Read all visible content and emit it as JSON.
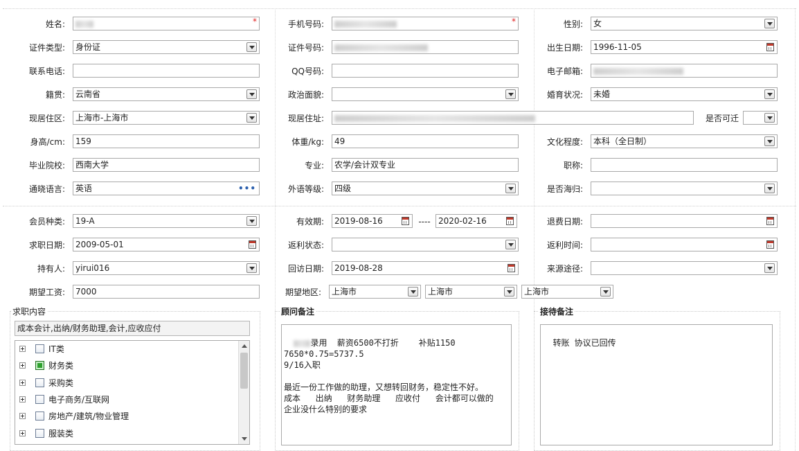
{
  "personal": {
    "name_label": "姓名:",
    "phone_label": "手机号码:",
    "gender_label": "性别:",
    "gender_value": "女",
    "id_type_label": "证件类型:",
    "id_type_value": "身份证",
    "id_no_label": "证件号码:",
    "birth_label": "出生日期:",
    "birth_value": "1996-11-05",
    "contact_label": "联系电话:",
    "qq_label": "QQ号码:",
    "email_label": "电子邮箱:",
    "native_label": "籍贯:",
    "native_value": "云南省",
    "politics_label": "政治面貌:",
    "marital_label": "婚育状况:",
    "marital_value": "未婚",
    "residence_area_label": "现居住区:",
    "residence_area_value": "上海市-上海市",
    "address_label": "现居住址:",
    "relocate_label": "是否可迁",
    "height_label": "身高/cm:",
    "height_value": "159",
    "weight_label": "体重/kg:",
    "weight_value": "49",
    "education_label": "文化程度:",
    "education_value": "本科（全日制）",
    "school_label": "毕业院校:",
    "school_value": "西南大学",
    "major_label": "专业:",
    "major_value": "农学/会计双专业",
    "title_label": "职称:",
    "language_label": "通晓语言:",
    "language_value": "英语",
    "foreign_level_label": "外语等级:",
    "foreign_level_value": "四级",
    "overseas_label": "是否海归:",
    "required_mark": "*"
  },
  "membership": {
    "type_label": "会员种类:",
    "type_value": "19-A",
    "valid_label": "有效期:",
    "valid_from": "2019-08-16",
    "valid_sep": "----",
    "valid_to": "2020-02-16",
    "refund_label": "退费日期:",
    "apply_label": "求职日期:",
    "apply_value": "2009-05-01",
    "rebate_status_label": "返利状态:",
    "rebate_time_label": "返利时间:",
    "holder_label": "持有人:",
    "holder_value": "yirui016",
    "revisit_label": "回访日期:",
    "revisit_value": "2019-08-28",
    "source_label": "来源途径:",
    "salary_label": "期望工资:",
    "salary_value": "7000",
    "region_label": "期望地区:",
    "region_1": "上海市",
    "region_2": "上海市",
    "region_3": "上海市"
  },
  "job": {
    "group_label": "求职内容",
    "summary": "成本会计,出纳/财务助理,会计,应收应付",
    "tree": [
      {
        "label": "IT类",
        "checked": false
      },
      {
        "label": "财务类",
        "checked": true
      },
      {
        "label": "采购类",
        "checked": false
      },
      {
        "label": "电子商务/互联网",
        "checked": false
      },
      {
        "label": "房地产/建筑/物业管理",
        "checked": false
      },
      {
        "label": "服装类",
        "checked": false
      }
    ]
  },
  "advisor": {
    "group_label": "顾问备注",
    "text": "录用  薪资6500不打折    补贴1150\n7650*0.75=5737.5\n9/16入职\n\n最近一份工作做的助理，又想转回财务，稳定性不好。\n成本   出纳   财务助理   应收付   会计都可以做的\n企业没什么特别的要求"
  },
  "reception": {
    "group_label": "接待备注",
    "text": "转账 协议已回传"
  },
  "icons": {
    "dropdown": "chevron-down-icon",
    "calendar": "calendar-icon",
    "more": "ellipsis-icon",
    "expand": "plus-square-icon",
    "checkbox": "checkbox-icon"
  }
}
